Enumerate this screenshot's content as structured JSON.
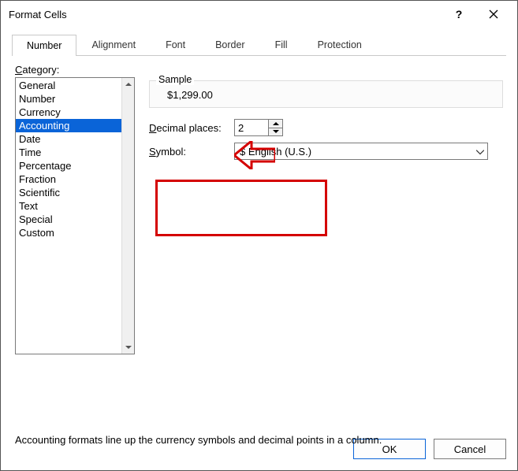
{
  "window": {
    "title": "Format Cells"
  },
  "titlebar": {
    "help": "?",
    "close": "×"
  },
  "tabs": [
    {
      "label": "Number",
      "active": true
    },
    {
      "label": "Alignment"
    },
    {
      "label": "Font"
    },
    {
      "label": "Border"
    },
    {
      "label": "Fill"
    },
    {
      "label": "Protection"
    }
  ],
  "category": {
    "label": "Category:",
    "items": [
      "General",
      "Number",
      "Currency",
      "Accounting",
      "Date",
      "Time",
      "Percentage",
      "Fraction",
      "Scientific",
      "Text",
      "Special",
      "Custom"
    ],
    "selected_index": 3
  },
  "sample": {
    "label": "Sample",
    "value": "$1,299.00"
  },
  "decimal": {
    "label": "Decimal places:",
    "value": "2"
  },
  "symbol": {
    "label": "Symbol:",
    "value": "$ English (U.S.)"
  },
  "description": "Accounting formats line up the currency symbols and decimal points in a column.",
  "footer": {
    "ok": "OK",
    "cancel": "Cancel"
  }
}
